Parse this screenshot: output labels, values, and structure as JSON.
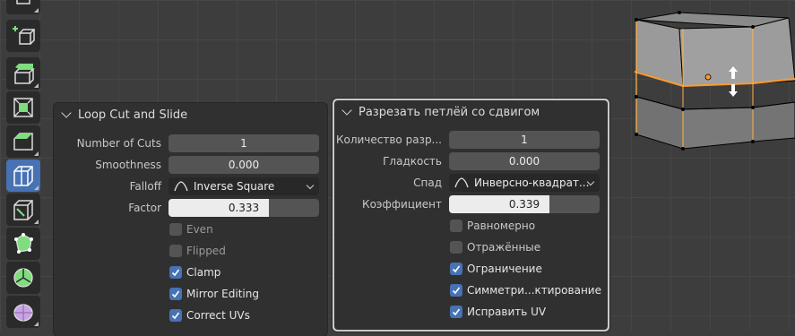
{
  "toolbar": {
    "tools": [
      {
        "icon": "cursor-icon",
        "active": false
      },
      {
        "icon": "add-cube-icon",
        "active": false
      },
      {
        "icon": "extrude-region-icon",
        "active": false
      },
      {
        "icon": "inset-faces-icon",
        "active": false
      },
      {
        "icon": "bevel-icon",
        "active": false
      },
      {
        "icon": "loop-cut-icon",
        "active": true
      },
      {
        "icon": "knife-icon",
        "active": false
      },
      {
        "icon": "poly-build-icon",
        "active": false
      },
      {
        "icon": "spin-icon",
        "active": false
      },
      {
        "icon": "smooth-icon",
        "active": false
      }
    ]
  },
  "panel_en": {
    "title": "Loop Cut and Slide",
    "number_of_cuts": {
      "label": "Number of Cuts",
      "value": "1"
    },
    "smoothness": {
      "label": "Smoothness",
      "value": "0.000"
    },
    "falloff": {
      "label": "Falloff",
      "value": "Inverse Square"
    },
    "factor": {
      "label": "Factor",
      "value": "0.333",
      "fraction": 0.667
    },
    "even": {
      "label": "Even",
      "checked": false
    },
    "flipped": {
      "label": "Flipped",
      "checked": false
    },
    "clamp": {
      "label": "Clamp",
      "checked": true
    },
    "mirror_editing": {
      "label": "Mirror Editing",
      "checked": true
    },
    "correct_uvs": {
      "label": "Correct UVs",
      "checked": true
    }
  },
  "panel_ru": {
    "title": "Разрезать петлёй со сдвигом",
    "number_of_cuts": {
      "label": "Количество разр...",
      "value": "1"
    },
    "smoothness": {
      "label": "Гладкость",
      "value": "0.000"
    },
    "falloff": {
      "label": "Спад",
      "value": "Инверсно-квадрат..."
    },
    "factor": {
      "label": "Коэффициент",
      "value": "0.339",
      "fraction": 0.667
    },
    "even": {
      "label": "Равномерно",
      "checked": false
    },
    "flipped": {
      "label": "Отражённые",
      "checked": false
    },
    "clamp": {
      "label": "Ограничение",
      "checked": true
    },
    "mirror_editing": {
      "label": "Симметри...ктирование",
      "checked": true
    },
    "correct_uvs": {
      "label": "Исправить UV",
      "checked": true
    }
  },
  "colors": {
    "accent": "#4772b3",
    "selection_edge": "#ff9a2e",
    "panel_bg": "#303030",
    "field_bg": "#545454"
  }
}
